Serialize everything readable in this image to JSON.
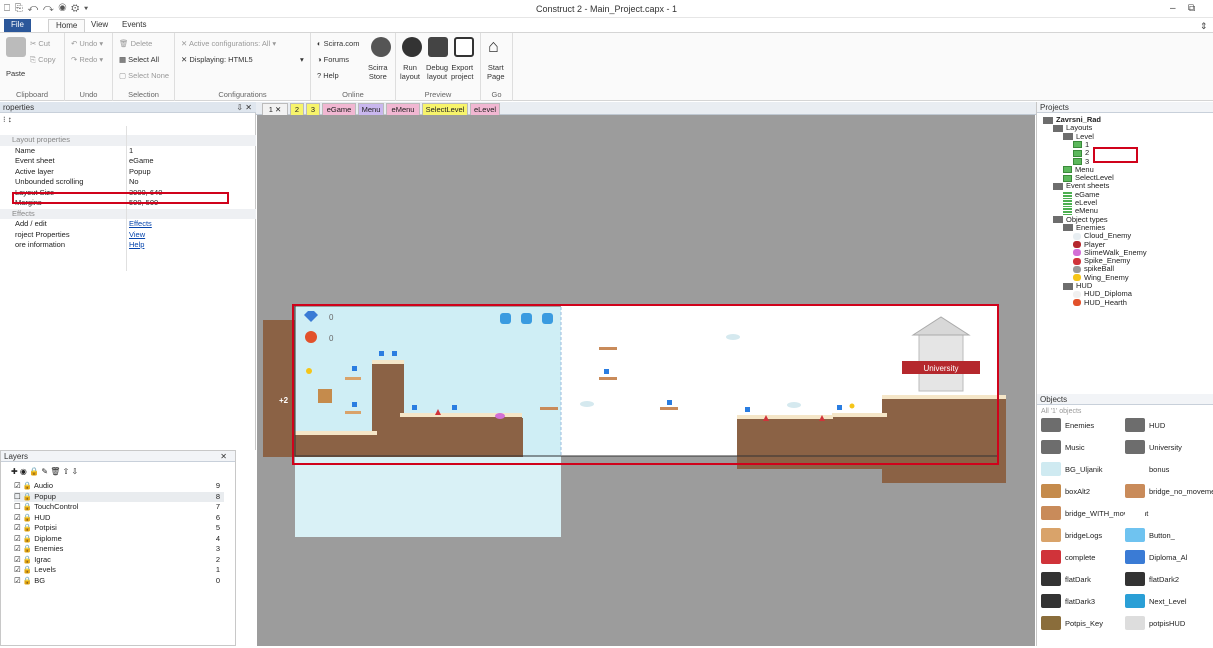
{
  "window": {
    "title": "Construct 2 - Main_Project.capx - 1",
    "quick_access": "⎕ ⎘ ↶ ↷ ◉ ⚙ ▾",
    "min": "–",
    "max": "⧉"
  },
  "ribbon_tabs": {
    "file": "File",
    "home": "Home",
    "view": "View",
    "events": "Events"
  },
  "ribbon": {
    "clipboard": {
      "paste": "Paste",
      "cut": "Cut",
      "copy": "Copy",
      "label": "Clipboard"
    },
    "undo": {
      "undo": "Undo",
      "redo": "Redo",
      "label": "Undo"
    },
    "selection": {
      "delete": "Delete",
      "select_all": "Select All",
      "select_none": "Select None",
      "label": "Selection"
    },
    "configurations": {
      "active": "Active configurations: All",
      "displaying": "Displaying: HTML5",
      "label": "Configurations"
    },
    "online": {
      "scirra": "Scirra.com",
      "forums": "Forums",
      "help": "Help",
      "store": "Scirra\nStore",
      "label": "Online"
    },
    "preview": {
      "run": "Run\nlayout",
      "debug": "Debug\nlayout",
      "export": "Export\nproject",
      "label": "Preview"
    },
    "go": {
      "start": "Start\nPage",
      "label": "Go"
    }
  },
  "properties": {
    "title": "Properties",
    "title_short": "roperties",
    "pin": "⇩ ✕",
    "sort": "⁝ ↕",
    "rows": [
      {
        "k": "Layout properties",
        "v": "",
        "cat": true
      },
      {
        "k": "Name",
        "v": "1"
      },
      {
        "k": "Event sheet",
        "v": "eGame"
      },
      {
        "k": "Active layer",
        "v": "Popup"
      },
      {
        "k": "Unbounded scrolling",
        "v": "No"
      },
      {
        "k": "Layout Size",
        "v": "3000, 640"
      },
      {
        "k": "Margins",
        "v": "500, 500"
      },
      {
        "k": "Effects",
        "v": "",
        "cat": true
      },
      {
        "k": "Add / edit",
        "v": "Effects",
        "link": true
      },
      {
        "k": "roject Properties",
        "v": "View",
        "link": true
      },
      {
        "k": "ore information",
        "v": "Help",
        "link": true
      }
    ]
  },
  "layers": {
    "title": "Layers",
    "close": "✕",
    "toolbar": "✚ ◉ 🔒 ✎ 🗑 ⇧ ⇩",
    "rows": [
      {
        "n": "☑ 🔒 Audio",
        "c": "9"
      },
      {
        "n": "☐ 🔒 Popup",
        "c": "8",
        "sel": true
      },
      {
        "n": "☐ 🔒 TouchControl",
        "c": "7"
      },
      {
        "n": "☑ 🔒 HUD",
        "c": "6"
      },
      {
        "n": "☑ 🔒 Potpisi",
        "c": "5"
      },
      {
        "n": "☑ 🔒 Diplome",
        "c": "4"
      },
      {
        "n": "☑ 🔒 Enemies",
        "c": "3"
      },
      {
        "n": "☑ 🔒 Igrac",
        "c": "2"
      },
      {
        "n": "☑ 🔒 Levels",
        "c": "1"
      },
      {
        "n": "☑ 🔒 BG",
        "c": "0"
      }
    ]
  },
  "layout_tabs": [
    {
      "label": "1 ✕",
      "color": "#f2f2f2"
    },
    {
      "label": "2",
      "color": "#f7f46b"
    },
    {
      "label": "3",
      "color": "#f7f46b"
    },
    {
      "label": "eGame",
      "color": "#f1b7d2"
    },
    {
      "label": "Menu",
      "color": "#c9b7ee"
    },
    {
      "label": "eMenu",
      "color": "#f1b7d2"
    },
    {
      "label": "SelectLevel",
      "color": "#f7f46b"
    },
    {
      "label": "eLevel",
      "color": "#f1b7d2"
    }
  ],
  "canvas": {
    "plus_two": "+2",
    "counter_zero": "0",
    "university": "University"
  },
  "projects": {
    "title": "Projects",
    "tree": [
      {
        "t": "Zavrsni_Rad",
        "i": "fold",
        "d": 0,
        "bold": true
      },
      {
        "t": "Layouts",
        "i": "fold",
        "d": 1
      },
      {
        "t": "Level",
        "i": "fold",
        "d": 2
      },
      {
        "t": "1",
        "i": "lay",
        "d": 3
      },
      {
        "t": "2",
        "i": "lay",
        "d": 3
      },
      {
        "t": "3",
        "i": "lay",
        "d": 3
      },
      {
        "t": "Menu",
        "i": "lay",
        "d": 2
      },
      {
        "t": "SelectLevel",
        "i": "lay",
        "d": 2
      },
      {
        "t": "Event sheets",
        "i": "fold",
        "d": 1
      },
      {
        "t": "eGame",
        "i": "evs",
        "d": 2
      },
      {
        "t": "eLevel",
        "i": "evs",
        "d": 2
      },
      {
        "t": "eMenu",
        "i": "evs",
        "d": 2
      },
      {
        "t": "Object types",
        "i": "fold",
        "d": 1
      },
      {
        "t": "Enemies",
        "i": "fold",
        "d": 2
      },
      {
        "t": "Cloud_Enemy",
        "i": "cloud",
        "d": 3
      },
      {
        "t": "Player",
        "i": "player",
        "d": 3
      },
      {
        "t": "SlimeWalk_Enemy",
        "i": "slime",
        "d": 3
      },
      {
        "t": "Spike_Enemy",
        "i": "spike",
        "d": 3
      },
      {
        "t": "spikeBall",
        "i": "ball",
        "d": 3
      },
      {
        "t": "Wing_Enemy",
        "i": "wing",
        "d": 3
      },
      {
        "t": "HUD",
        "i": "fold",
        "d": 2
      },
      {
        "t": "HUD_Diploma",
        "i": "diploma",
        "d": 3
      },
      {
        "t": "HUD_Hearth",
        "i": "heart",
        "d": 3
      }
    ]
  },
  "objects": {
    "title": "Objects",
    "subtitle": "All '1' objects",
    "items": [
      {
        "n": "Enemies",
        "c": "#6d6d6d"
      },
      {
        "n": "HUD",
        "c": "#6d6d6d"
      },
      {
        "n": "Music",
        "c": "#6d6d6d"
      },
      {
        "n": "University",
        "c": "#6d6d6d"
      },
      {
        "n": "BG_Uljanik",
        "c": "#cfeaf1"
      },
      {
        "n": "bonus",
        "c": "#ffffff"
      },
      {
        "n": "boxAlt2",
        "c": "#c58b4c"
      },
      {
        "n": "bridge_no_movement",
        "c": "#c98b5a"
      },
      {
        "n": "bridge_WITH_movement",
        "c": "#c98b5a"
      },
      {
        "n": "",
        "c": "#ffffff"
      },
      {
        "n": "bridgeLogs",
        "c": "#d9a36a"
      },
      {
        "n": "Button_",
        "c": "#6fc3f0"
      },
      {
        "n": "complete",
        "c": "#d0333a"
      },
      {
        "n": "Diploma_Al",
        "c": "#3a7bd5"
      },
      {
        "n": "flatDark",
        "c": "#333333"
      },
      {
        "n": "flatDark2",
        "c": "#333333"
      },
      {
        "n": "flatDark3",
        "c": "#333333"
      },
      {
        "n": "Next_Level",
        "c": "#2a9fd6"
      },
      {
        "n": "Potpis_Key",
        "c": "#8a6d3b"
      },
      {
        "n": "potpisHUD",
        "c": "#dddddd"
      }
    ]
  }
}
